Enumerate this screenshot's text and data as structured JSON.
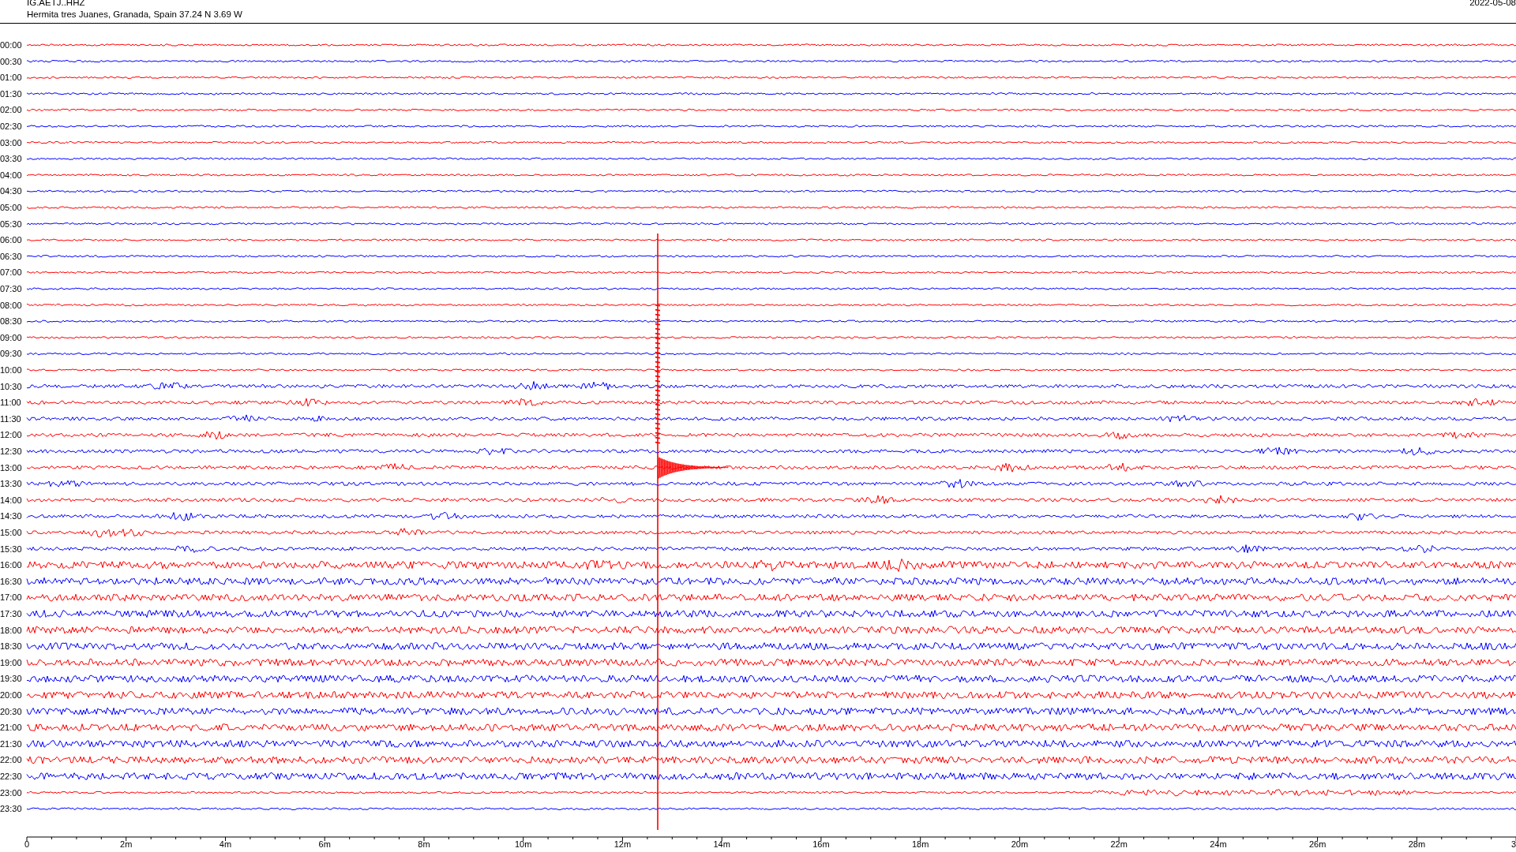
{
  "header": {
    "station": "IG.AETJ..HHZ",
    "location": "Hermita tres Juanes, Granada, Spain  37.24 N 3.69 W",
    "date": "2022-05-08"
  },
  "traces": [
    {
      "label": "00:00",
      "color": "#ff0000"
    },
    {
      "label": "00:30",
      "color": "#0000ff"
    },
    {
      "label": "01:00",
      "color": "#ff0000"
    },
    {
      "label": "01:30",
      "color": "#0000ff"
    },
    {
      "label": "02:00",
      "color": "#ff0000"
    },
    {
      "label": "02:30",
      "color": "#0000ff"
    },
    {
      "label": "03:00",
      "color": "#ff0000"
    },
    {
      "label": "03:30",
      "color": "#0000ff"
    },
    {
      "label": "04:00",
      "color": "#ff0000"
    },
    {
      "label": "04:30",
      "color": "#0000ff"
    },
    {
      "label": "05:00",
      "color": "#ff0000"
    },
    {
      "label": "05:30",
      "color": "#0000ff"
    },
    {
      "label": "06:00",
      "color": "#ff0000"
    },
    {
      "label": "06:30",
      "color": "#0000ff"
    },
    {
      "label": "07:00",
      "color": "#ff0000"
    },
    {
      "label": "07:30",
      "color": "#0000ff"
    },
    {
      "label": "08:00",
      "color": "#ff0000"
    },
    {
      "label": "08:30",
      "color": "#0000ff"
    },
    {
      "label": "09:00",
      "color": "#ff0000"
    },
    {
      "label": "09:30",
      "color": "#0000ff"
    },
    {
      "label": "10:00",
      "color": "#ff0000"
    },
    {
      "label": "10:30",
      "color": "#0000ff"
    },
    {
      "label": "11:00",
      "color": "#ff0000"
    },
    {
      "label": "11:30",
      "color": "#0000ff"
    },
    {
      "label": "12:00",
      "color": "#ff0000"
    },
    {
      "label": "12:30",
      "color": "#0000ff"
    },
    {
      "label": "13:00",
      "color": "#ff0000"
    },
    {
      "label": "13:30",
      "color": "#0000ff"
    },
    {
      "label": "14:00",
      "color": "#ff0000"
    },
    {
      "label": "14:30",
      "color": "#0000ff"
    },
    {
      "label": "15:00",
      "color": "#ff0000"
    },
    {
      "label": "15:30",
      "color": "#0000ff"
    },
    {
      "label": "16:00",
      "color": "#ff0000"
    },
    {
      "label": "16:30",
      "color": "#0000ff"
    },
    {
      "label": "17:00",
      "color": "#ff0000"
    },
    {
      "label": "17:30",
      "color": "#0000ff"
    },
    {
      "label": "18:00",
      "color": "#ff0000"
    },
    {
      "label": "18:30",
      "color": "#0000ff"
    },
    {
      "label": "19:00",
      "color": "#ff0000"
    },
    {
      "label": "19:30",
      "color": "#0000ff"
    },
    {
      "label": "20:00",
      "color": "#ff0000"
    },
    {
      "label": "20:30",
      "color": "#0000ff"
    },
    {
      "label": "21:00",
      "color": "#ff0000"
    },
    {
      "label": "21:30",
      "color": "#0000ff"
    },
    {
      "label": "22:00",
      "color": "#ff0000"
    },
    {
      "label": "22:30",
      "color": "#0000ff"
    },
    {
      "label": "23:00",
      "color": "#ff0000"
    },
    {
      "label": "23:30",
      "color": "#0000ff"
    }
  ],
  "axis_labels": [
    "0",
    "2m",
    "4m",
    "6m",
    "8m",
    "10m",
    "12m",
    "14m",
    "16m",
    "18m",
    "20m",
    "22m",
    "24m",
    "26m",
    "28m",
    "3"
  ]
}
